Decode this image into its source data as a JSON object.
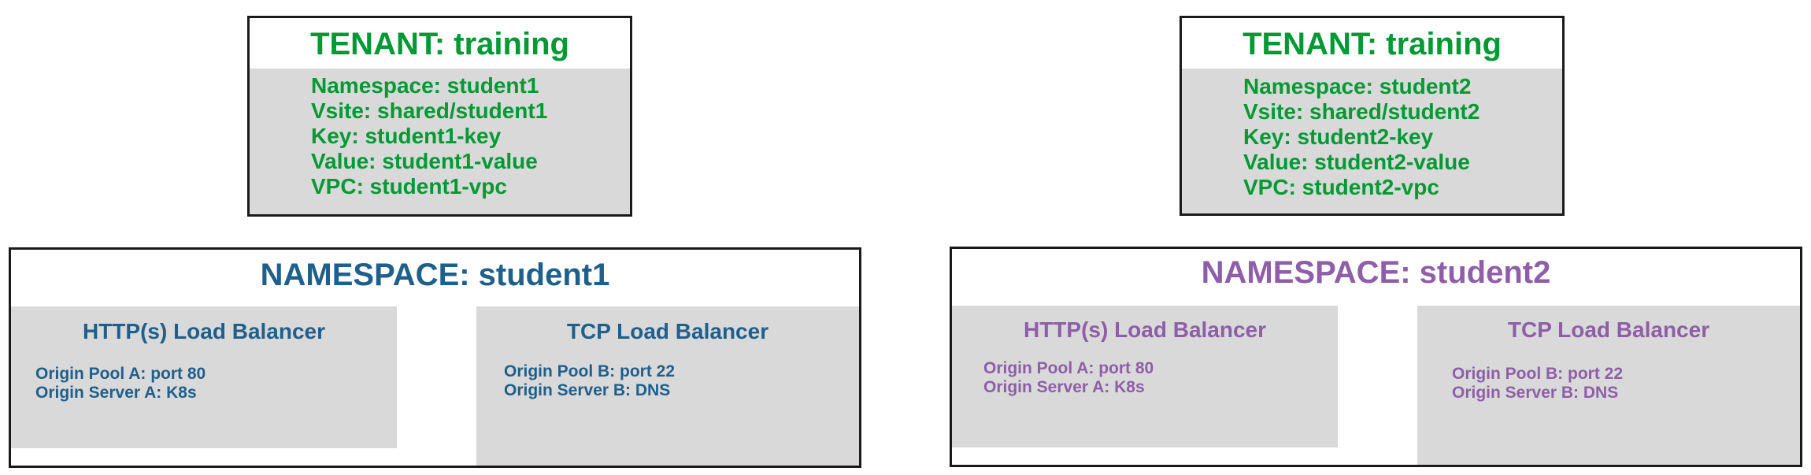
{
  "colors": {
    "tenant_text": "#009933",
    "ns1_text": "#1f5f8b",
    "ns2_text": "#8e5ea8",
    "panel_fill": "#d9d9d9",
    "border": "#1a1a1a"
  },
  "tenant1": {
    "title": "TENANT: training",
    "lines": [
      "Namespace: student1",
      "Vsite: shared/student1",
      "Key: student1-key",
      "Value: student1-value",
      "VPC: student1-vpc"
    ]
  },
  "tenant2": {
    "title": "TENANT: training",
    "lines": [
      "Namespace: student2",
      "Vsite: shared/student2",
      "Key: student2-key",
      "Value: student2-value",
      "VPC: student2-vpc"
    ]
  },
  "namespace1": {
    "title": "NAMESPACE: student1",
    "http_lb": {
      "title": "HTTP(s) Load Balancer",
      "lines": [
        "Origin Pool A: port 80",
        "Origin Server A: K8s"
      ]
    },
    "tcp_lb": {
      "title": "TCP Load Balancer",
      "lines": [
        "Origin Pool B: port 22",
        "Origin Server B: DNS"
      ]
    }
  },
  "namespace2": {
    "title": "NAMESPACE: student2",
    "http_lb": {
      "title": "HTTP(s) Load Balancer",
      "lines": [
        "Origin Pool A: port 80",
        "Origin Server A: K8s"
      ]
    },
    "tcp_lb": {
      "title": "TCP Load Balancer",
      "lines": [
        "Origin Pool B: port 22",
        "Origin Server B: DNS"
      ]
    }
  }
}
